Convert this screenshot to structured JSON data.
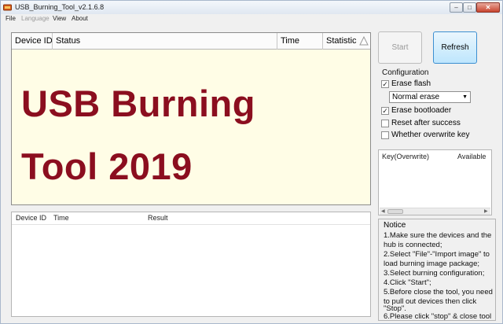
{
  "window": {
    "title": "USB_Burning_Tool_v2.1.6.8",
    "minimize_glyph": "–",
    "maximize_glyph": "□",
    "close_glyph": "✕"
  },
  "menu": [
    {
      "label": "File"
    },
    {
      "label": "Language"
    },
    {
      "label": "View"
    },
    {
      "label": "About"
    }
  ],
  "device_table": {
    "columns": [
      "Device ID",
      "Status",
      "Time",
      "Statistic"
    ]
  },
  "overlay": {
    "line1": "USB Burning",
    "line2": "Tool 2019",
    "color": "#8b0e1f"
  },
  "result_table": {
    "columns": [
      "Device ID",
      "Time",
      "Result"
    ]
  },
  "buttons": {
    "start": "Start",
    "refresh": "Refresh"
  },
  "configuration": {
    "title": "Configuration",
    "erase_flash": {
      "label": "Erase flash",
      "checked": true
    },
    "erase_mode": "Normal erase",
    "erase_bootloader": {
      "label": "Erase bootloader",
      "checked": true
    },
    "reset_after_success": {
      "label": "Reset after success",
      "checked": false
    },
    "whether_overwrite_key": {
      "label": "Whether overwrite key",
      "checked": false
    }
  },
  "key_table": {
    "columns": [
      "Key(Overwrite)",
      "Available"
    ]
  },
  "notice": {
    "title": "Notice",
    "lines": [
      "1.Make sure the devices and the",
      "hub is connected;",
      "2.Select \"File\"-\"Import image\" to",
      "load burning image package;",
      "3.Select burning configuration;",
      "4.Click \"Start\";",
      "5.Before close the tool, you need",
      "to pull out devices then click",
      "\"Stop\".",
      "6.Please click \"stop\" & close tool"
    ]
  },
  "check_glyph": "✓"
}
